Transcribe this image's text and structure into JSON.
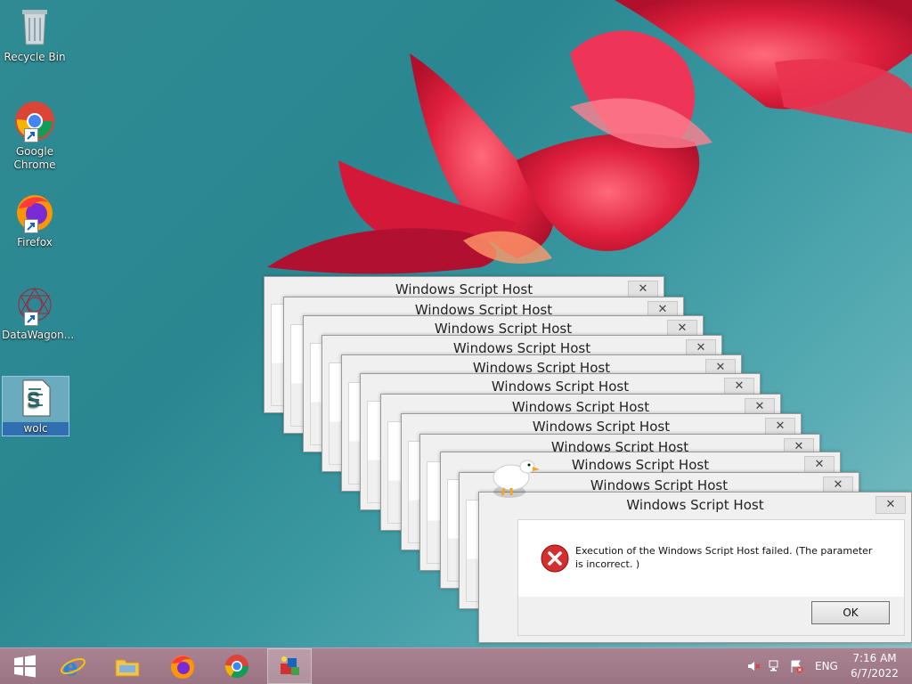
{
  "desktop": {
    "icons": [
      {
        "label": "Recycle Bin",
        "icon": "recycle-bin-icon"
      },
      {
        "label": "Google Chrome",
        "icon": "chrome-icon"
      },
      {
        "label": "Firefox",
        "icon": "firefox-icon"
      },
      {
        "label": "DataWagon...",
        "icon": "datawagon-icon"
      },
      {
        "label": "wolc",
        "icon": "script-file-icon"
      }
    ]
  },
  "dialogs": {
    "title": "Windows Script Host",
    "close_glyph": "✕",
    "message": "Execution of the Windows Script Host failed. (The parameter is incorrect. )",
    "ok_label": "OK"
  },
  "taskbar": {
    "start": "windows-start-icon",
    "pinned": [
      "internet-explorer-icon",
      "file-explorer-icon",
      "firefox-icon",
      "chrome-icon",
      "script-app-icon"
    ],
    "tray": {
      "language": "ENG",
      "time": "7:16 AM",
      "date": "6/7/2022"
    }
  },
  "colors": {
    "error_red": "#d32f2f",
    "taskbar": "#a07a89"
  }
}
